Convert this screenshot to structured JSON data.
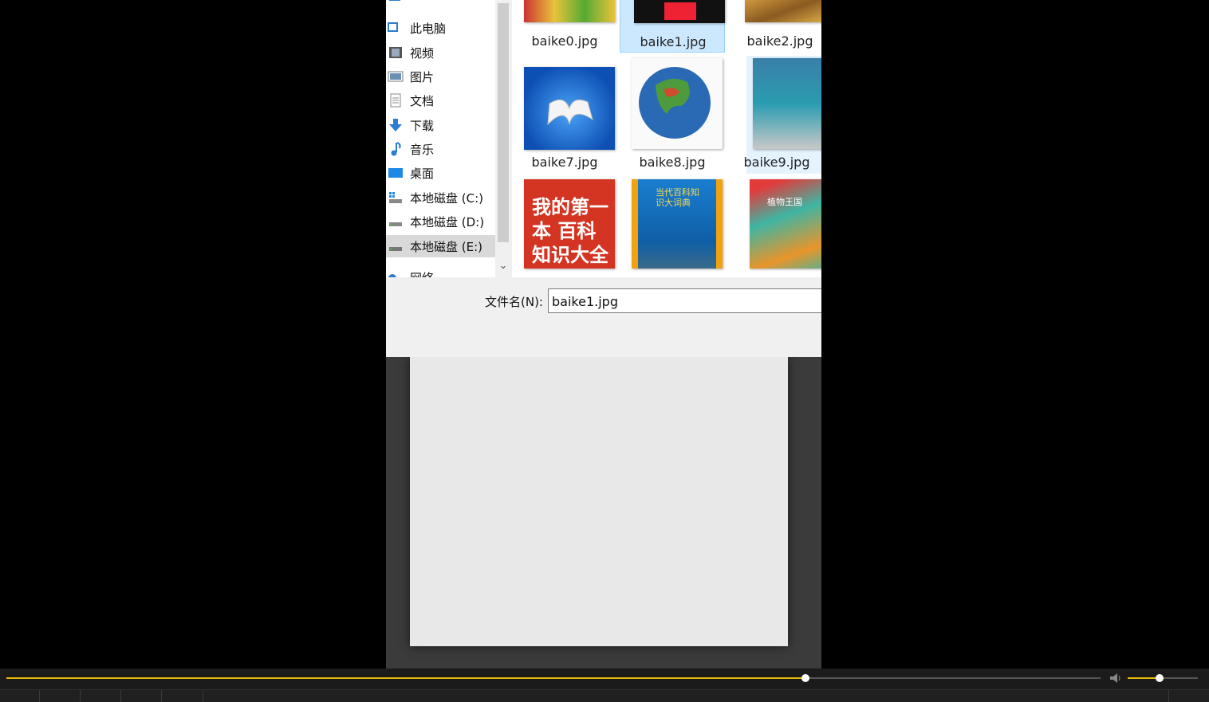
{
  "nav": {
    "items": [
      {
        "label": "此电脑",
        "icon": "pc-icon"
      },
      {
        "label": "视频",
        "icon": "video-icon"
      },
      {
        "label": "图片",
        "icon": "pictures-icon"
      },
      {
        "label": "文档",
        "icon": "documents-icon"
      },
      {
        "label": "下载",
        "icon": "download-icon"
      },
      {
        "label": "音乐",
        "icon": "music-icon"
      },
      {
        "label": "桌面",
        "icon": "desktop-icon"
      },
      {
        "label": "本地磁盘 (C:)",
        "icon": "drive-icon"
      },
      {
        "label": "本地磁盘 (D:)",
        "icon": "drive-icon"
      },
      {
        "label": "本地磁盘 (E:)",
        "icon": "drive-icon",
        "selected": true
      },
      {
        "label": "网络",
        "icon": "network-icon"
      }
    ]
  },
  "files": [
    {
      "name": "baike0.jpg"
    },
    {
      "name": "baike1.jpg",
      "selected": true
    },
    {
      "name": "baike2.jpg"
    },
    {
      "name": "baike7.jpg"
    },
    {
      "name": "baike8.jpg"
    },
    {
      "name": "baike9.jpg"
    },
    {
      "name": "",
      "cover_text": "我的第一本 百科知识大全"
    },
    {
      "name": "",
      "cover_text": "当代百科知识大词典"
    },
    {
      "name": "",
      "cover_text": "植物王国"
    }
  ],
  "filename": {
    "label": "文件名(N):",
    "value": "baike1.jpg"
  },
  "player": {
    "progress_fraction": 0.73,
    "volume_fraction": 0.45,
    "accent": "#e6b800"
  }
}
